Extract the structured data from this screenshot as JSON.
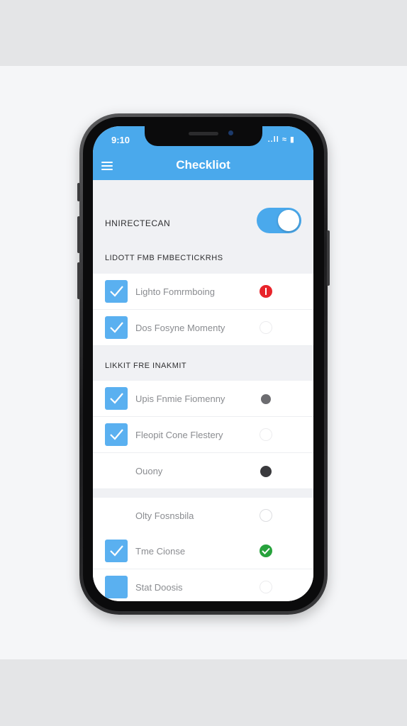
{
  "status_bar": {
    "time": "9:10",
    "icons": "..ll ≈ ▮"
  },
  "header": {
    "title": "Checkliot"
  },
  "setting": {
    "label": "HNIRECTECAN",
    "toggle_on": true
  },
  "sections": [
    {
      "header": "LIDOTT FMB FMBECTICKRHS"
    },
    {
      "header": "LIKKIT FRE INAKMIT"
    }
  ],
  "items": [
    {
      "label": "Lighto Fomrmboing",
      "checked": true,
      "status": "alert"
    },
    {
      "label": "Dos Fosyne Momenty",
      "checked": true,
      "status": "none"
    },
    {
      "label": "Upis Fnmie Fiomenny",
      "checked": true,
      "status": "gray"
    },
    {
      "label": "Fleopit Cone Flestery",
      "checked": true,
      "status": "none"
    },
    {
      "label": "Ouony",
      "checked": false,
      "status": "dark"
    },
    {
      "label": "Olty Fosnsbila",
      "checked": false,
      "status": "none"
    },
    {
      "label": "Tme Cionse",
      "checked": true,
      "status": "done"
    },
    {
      "label": "Stat Doosis",
      "checked": false,
      "status": "none"
    }
  ],
  "colors": {
    "accent": "#4aa9ec",
    "alert": "#e8232a",
    "done": "#27a23c"
  }
}
